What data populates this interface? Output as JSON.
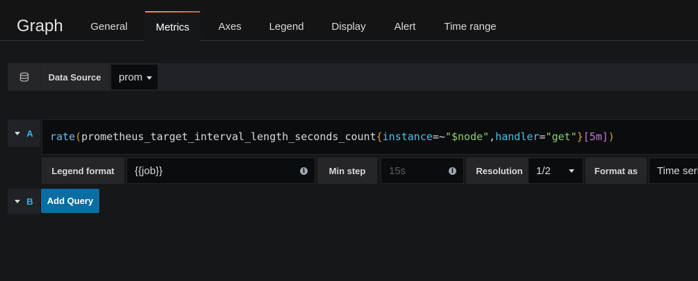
{
  "panel_title": "Graph",
  "tabs": [
    {
      "label": "General"
    },
    {
      "label": "Metrics"
    },
    {
      "label": "Axes"
    },
    {
      "label": "Legend"
    },
    {
      "label": "Display"
    },
    {
      "label": "Alert"
    },
    {
      "label": "Time range"
    }
  ],
  "active_tab": "Metrics",
  "datasource": {
    "label": "Data Source",
    "value": "prom",
    "icon": "database-icon"
  },
  "queries": [
    {
      "ref": "A",
      "expression": "rate(prometheus_target_interval_length_seconds_count{instance=~\"$node\",handler=\"get\"}[5m])",
      "tokens": {
        "fn": "rate",
        "p_open": "(",
        "metric": "prometheus_target_interval_length_seconds_count",
        "b_open": "{",
        "label1": "instance",
        "op1": "=~",
        "val1": "\"$node\"",
        "comma": ",",
        "label2": "handler",
        "op2": "=",
        "val2": "\"get\"",
        "b_close": "}",
        "sq_open": "[",
        "range": "5m",
        "sq_close": "]",
        "p_close": ")"
      },
      "options": {
        "legend_format_label": "Legend format",
        "legend_format_value": "{{job}}",
        "min_step_label": "Min step",
        "min_step_placeholder": "15s",
        "resolution_label": "Resolution",
        "resolution_value": "1/2",
        "format_as_label": "Format as",
        "format_as_value": "Time series"
      }
    },
    {
      "ref": "B",
      "add_query_label": "Add Query"
    }
  ],
  "colors": {
    "accent": "#f3902b",
    "primary_button": "#0a6ea3",
    "ref_letter": "#33b5e5"
  }
}
